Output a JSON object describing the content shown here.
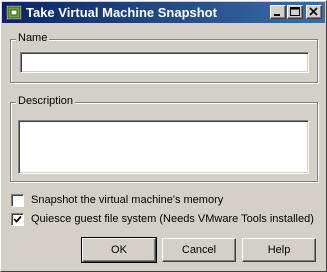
{
  "window": {
    "title": "Take Virtual Machine Snapshot",
    "controls": [
      "minimize-icon",
      "maximize-icon",
      "close-icon"
    ]
  },
  "name_group": {
    "label": "Name",
    "value": "",
    "placeholder": ""
  },
  "description_group": {
    "label": "Description",
    "value": "",
    "placeholder": ""
  },
  "options": {
    "memory": {
      "label": "Snapshot the virtual machine's memory",
      "checked": false
    },
    "quiesce": {
      "label": "Quiesce guest file system (Needs VMware Tools installed)",
      "checked": true
    }
  },
  "buttons": {
    "ok": "OK",
    "cancel": "Cancel",
    "help": "Help"
  },
  "colors": {
    "title_bar_start": "#0a246a",
    "title_bar_end": "#3a6ea5",
    "face": "#d4d0c8",
    "app_icon": "#7ab648"
  }
}
